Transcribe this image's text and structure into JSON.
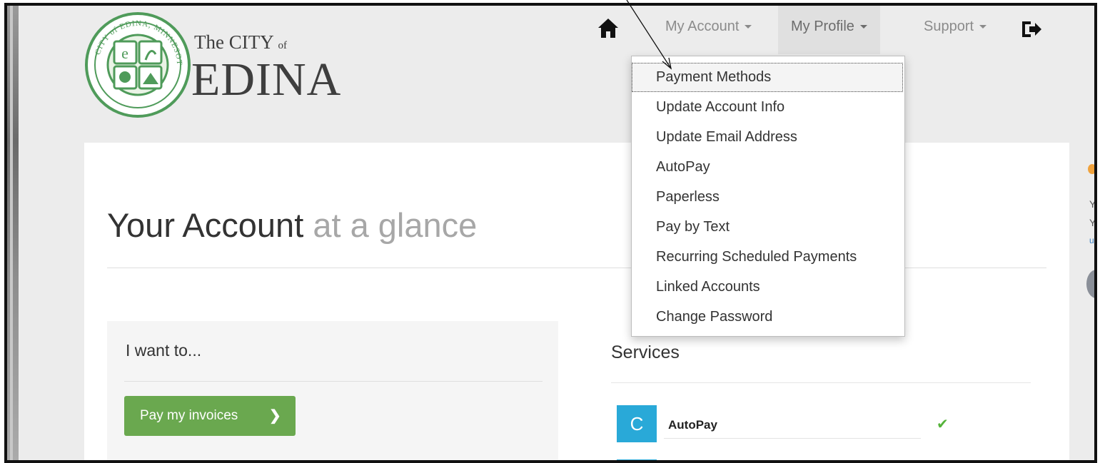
{
  "brand": {
    "the_city": "The CITY",
    "of": "of",
    "name": "EDINA",
    "seal_text": "CITY of EDINA, MINNESOTA"
  },
  "nav": {
    "home_icon": "home-icon",
    "my_account": "My Account",
    "my_profile": "My Profile",
    "support": "Support",
    "signout_icon": "sign-out-icon"
  },
  "profile_menu": {
    "items": [
      "Payment Methods",
      "Update Account Info",
      "Update Email Address",
      "AutoPay",
      "Paperless",
      "Pay by Text",
      "Recurring Scheduled Payments",
      "Linked Accounts",
      "Change Password"
    ]
  },
  "main": {
    "heading_strong": "Your Account",
    "heading_light": "at a glance",
    "i_want_to": "I want to...",
    "pay_button": "Pay my invoices",
    "pay_button_chevron": "❯",
    "services_title": "Services",
    "services": [
      {
        "icon": "refresh-icon",
        "glyph": "C",
        "label": "AutoPay",
        "status": "✔"
      }
    ]
  },
  "side_fragment": {
    "t1": "Y",
    "t2": "Y",
    "t3": "u"
  },
  "colors": {
    "accent_green": "#6aa84f",
    "service_blue": "#29a9d8",
    "check_green": "#55b33a"
  }
}
